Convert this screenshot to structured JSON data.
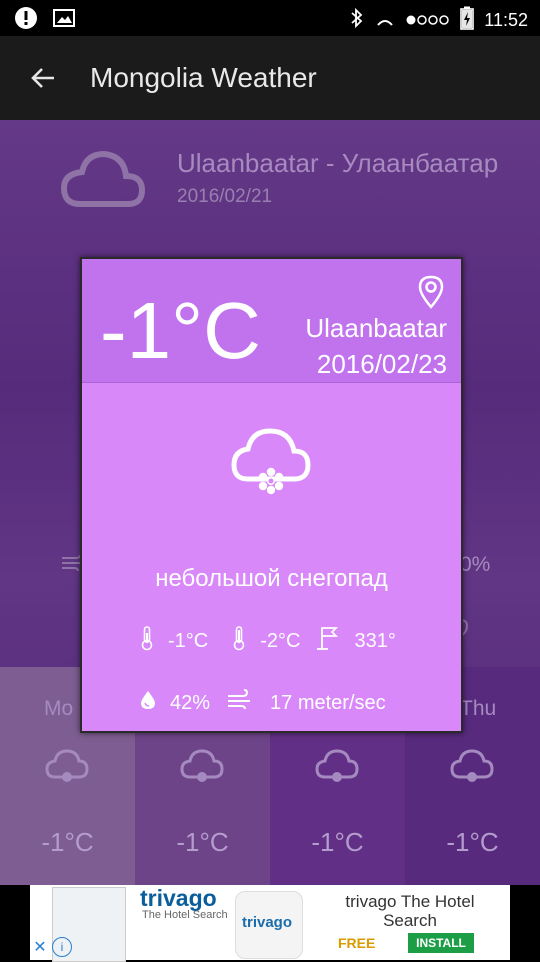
{
  "status_bar": {
    "time": "11:52",
    "icons": [
      "alert-icon",
      "image-icon",
      "bluetooth-icon",
      "wifi-icon",
      "signal-icon",
      "battery-charging-icon"
    ]
  },
  "app_bar": {
    "title": "Mongolia Weather"
  },
  "background": {
    "city": "Ulaanbaatar - Улаанбаатар",
    "date": "2016/02/21",
    "percent_partial": "0%",
    "forecast": [
      {
        "day": "Mo",
        "temp": "-1°C"
      },
      {
        "day": "",
        "temp": "-1°C"
      },
      {
        "day": "",
        "temp": "-1°C"
      },
      {
        "day": "Thu",
        "temp": "-1°C"
      }
    ]
  },
  "card": {
    "temperature": "-1°C",
    "city": "Ulaanbaatar",
    "date": "2016/02/23",
    "description": "небольшой снегопад",
    "temp_min": "-1°C",
    "temp_max": "-2°C",
    "wind_direction": "331°",
    "humidity": "42%",
    "wind_speed": "17 meter/sec",
    "accent_color": "#c173ee",
    "body_color": "#d888f8"
  },
  "ad": {
    "brand": "trivago",
    "brand_sub": "The Hotel Search",
    "app_icon_text": "trivago",
    "title": "trivago The Hotel Search",
    "price": "FREE",
    "install_label": "INSTALL",
    "close_label": "✕",
    "info_label": "i"
  }
}
